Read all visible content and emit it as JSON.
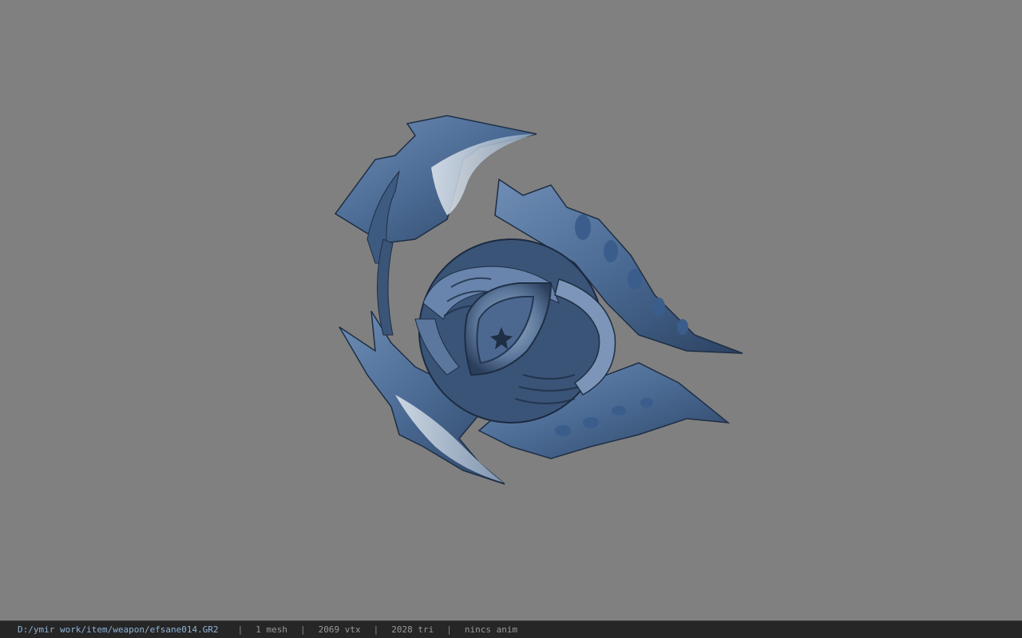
{
  "viewer": {
    "background_color": "#808080",
    "model": {
      "icon": "shuriken-weapon-model",
      "primary_color": "#4a6a93",
      "highlight_color": "#c9d4df",
      "shadow_color": "#1e2e44"
    }
  },
  "status_bar": {
    "file_path": "D:/ymir work/item/weapon/efsane014.GR2",
    "separator": "|",
    "mesh_count": "1 mesh",
    "vertex_count": "2069 vtx",
    "triangle_count": "2028 tri",
    "animation": "nincs anim"
  }
}
